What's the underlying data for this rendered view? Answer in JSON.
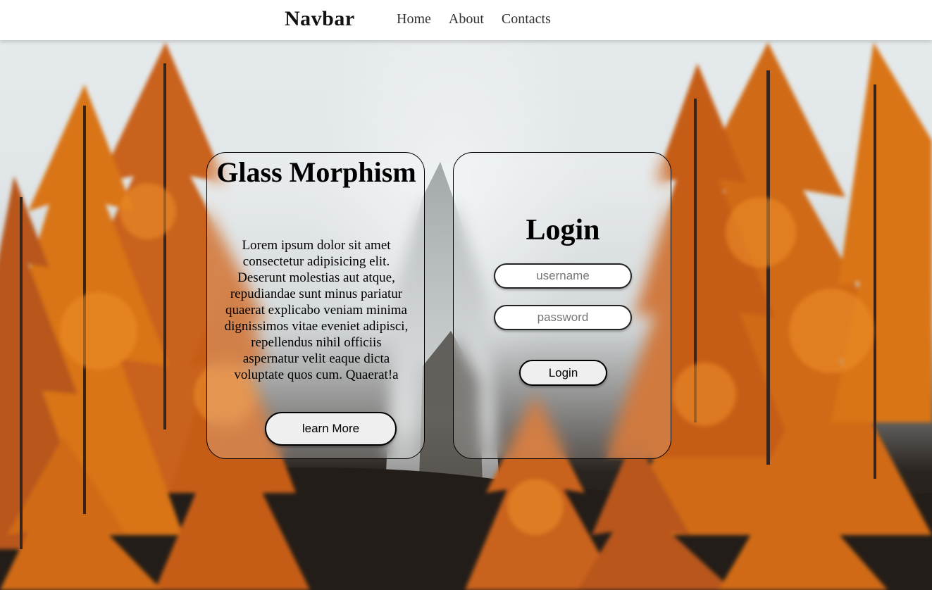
{
  "navbar": {
    "brand": "Navbar",
    "links": [
      "Home",
      "About",
      "Contacts"
    ]
  },
  "info_card": {
    "title": "Glass Morphism",
    "body": "Lorem ipsum dolor sit amet consectetur adipisicing elit. Deserunt molestias aut atque, repudiandae sunt minus pariatur quaerat explicabo veniam minima dignissimos vitae eveniet adipisci, repellendus nihil officiis aspernatur velit eaque dicta voluptate quos cum. Quaerat!a",
    "button_label": "learn More"
  },
  "login_card": {
    "title": "Login",
    "username_placeholder": "username",
    "password_placeholder": "password",
    "button_label": "Login"
  },
  "colors": {
    "foliage": "#d9701a",
    "foliage_dark": "#8a3a0c",
    "sky": "#e4e9eb",
    "navbar_bg": "#ffffff"
  }
}
